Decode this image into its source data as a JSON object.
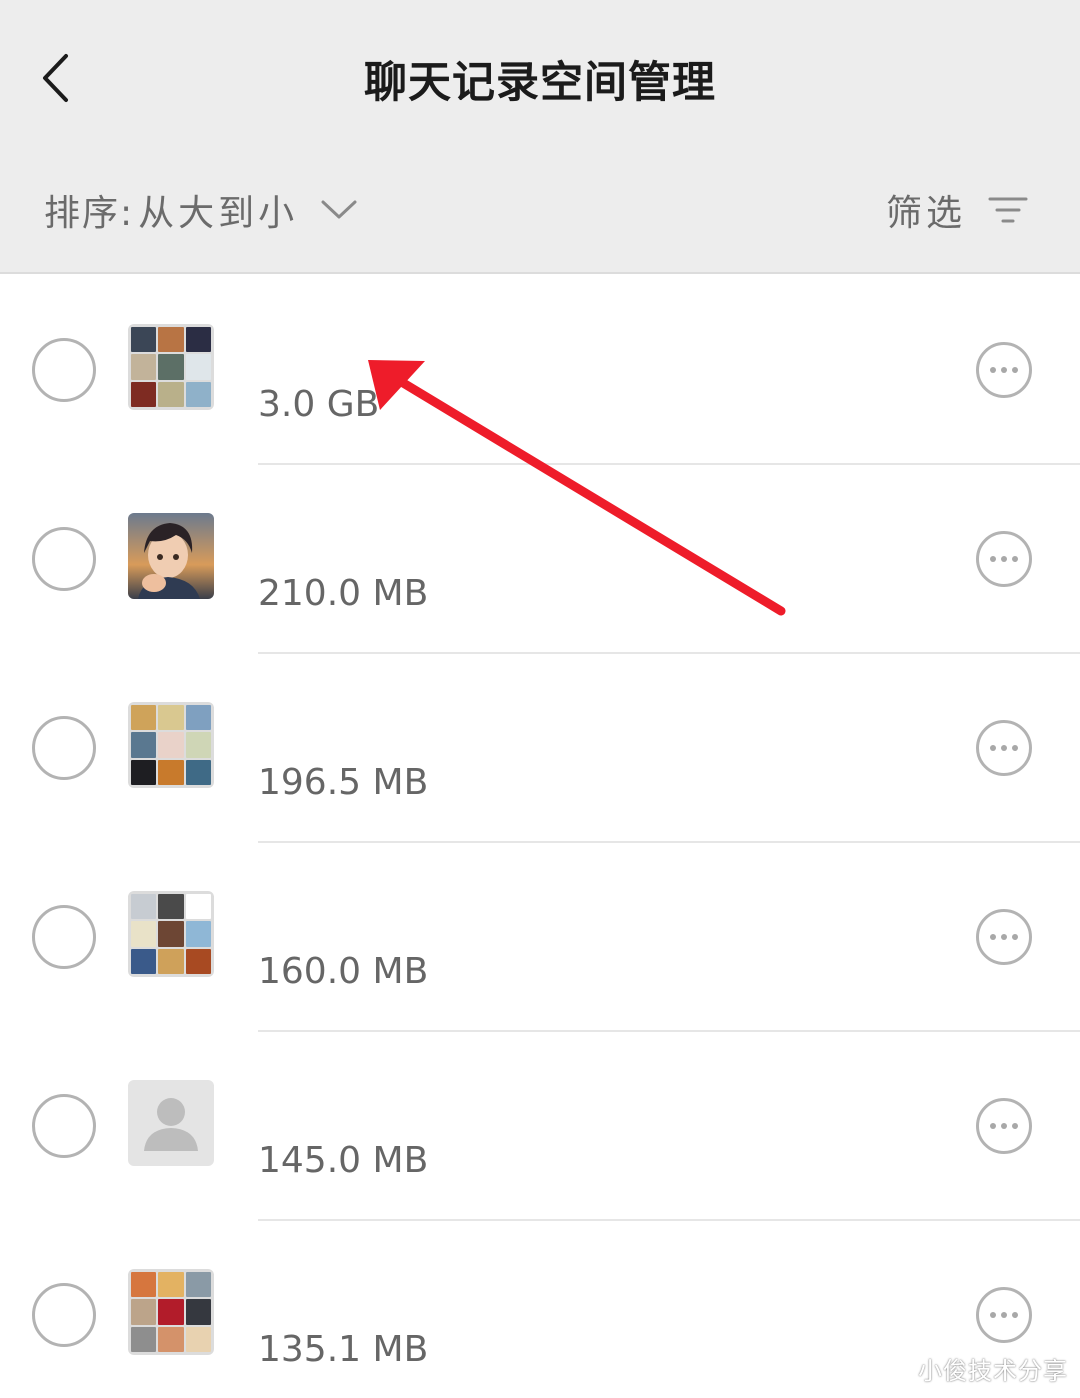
{
  "header": {
    "title": "聊天记录空间管理"
  },
  "sort": {
    "label": "排序:",
    "value": "从大到小"
  },
  "filter": {
    "label": "筛选"
  },
  "rows": [
    {
      "name": "",
      "size": "3.0 GB",
      "avatar": "group-grid",
      "tiles": [
        "#3b4656",
        "#b87444",
        "#2b2d44",
        "#c2b39a",
        "#5c6f66",
        "#dfe6ea",
        "#7e2b22",
        "#b9b08a",
        "#8fb1c9"
      ]
    },
    {
      "name": "",
      "size": "210.0 MB",
      "avatar": "anime-portrait"
    },
    {
      "name": "",
      "size": "196.5 MB",
      "avatar": "group-grid",
      "tiles": [
        "#cfa35a",
        "#d9c890",
        "#7fa0c0",
        "#5a7890",
        "#e9d2c9",
        "#cfd6b6",
        "#1e1e22",
        "#c87a2c",
        "#3f6a86"
      ]
    },
    {
      "name": "",
      "size": "160.0 MB",
      "avatar": "group-grid",
      "tiles": [
        "#c7ccd2",
        "#4a4a4a",
        "#ffffff",
        "#e9e2c8",
        "#6d4634",
        "#8fb7d6",
        "#3a5a8a",
        "#cfa15a",
        "#a84a22"
      ]
    },
    {
      "name": "",
      "size": "145.0 MB",
      "avatar": "default-person"
    },
    {
      "name": "",
      "size": "135.1 MB",
      "avatar": "group-grid",
      "tiles": [
        "#d6763e",
        "#e3b262",
        "#8a9aa6",
        "#bca48a",
        "#b21c2a",
        "#35383f",
        "#8e8e8e",
        "#d4926a",
        "#e8d2b0"
      ]
    }
  ],
  "watermark": "小俊技术分享",
  "colors": {
    "header_bg": "#ededed",
    "annotation_arrow": "#ee1c2a",
    "secondary_text": "#6b6b6b"
  },
  "icons": [
    "back-chevron-icon",
    "chevron-down-icon",
    "filter-lines-icon",
    "more-dots-icon",
    "person-icon"
  ]
}
